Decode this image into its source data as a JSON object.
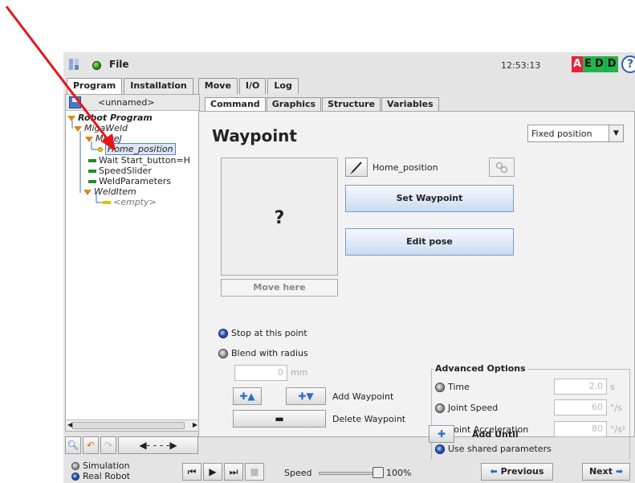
{
  "titlebar": {
    "file_label": "File",
    "clock": "12:53:13",
    "status_letters": [
      "A",
      "E",
      "D",
      "D"
    ],
    "help_label": "?"
  },
  "top_tabs": [
    "Program",
    "Installation",
    "Move",
    "I/O",
    "Log"
  ],
  "left_panel": {
    "program_name": "<unnamed>",
    "tree": [
      {
        "label": "Robot Program",
        "style": "bold-italic",
        "icon": "triangle-icon"
      },
      {
        "label": "MigaWeld",
        "style": "italic",
        "icon": "triangle-icon"
      },
      {
        "label": "MoveJ",
        "style": "italic",
        "icon": "triangle-icon"
      },
      {
        "label": "Home_position",
        "style": "selected-italic",
        "icon": "waypoint-dot-icon"
      },
      {
        "label": "Wait Start_button=H",
        "style": "normal",
        "icon": "command-icon"
      },
      {
        "label": "SpeedSlider",
        "style": "normal",
        "icon": "command-icon"
      },
      {
        "label": "WeldParameters",
        "style": "normal",
        "icon": "command-icon"
      },
      {
        "label": "WeldItem",
        "style": "italic",
        "icon": "triangle-icon"
      },
      {
        "label": "<empty>",
        "style": "muted-italic",
        "icon": "empty-command-icon"
      }
    ]
  },
  "sub_tabs": [
    "Command",
    "Graphics",
    "Structure",
    "Variables"
  ],
  "waypoint": {
    "title": "Waypoint",
    "position_type": "Fixed position",
    "preview_placeholder": "?",
    "move_here_label": "Move here",
    "name": "Home_position",
    "set_waypoint_label": "Set Waypoint",
    "edit_pose_label": "Edit pose",
    "stop_at_point_label": "Stop at this point",
    "blend_label": "Blend with radius",
    "blend_value": "0",
    "blend_unit": "mm",
    "add_waypoint_label": "Add Waypoint",
    "delete_waypoint_label": "Delete Waypoint",
    "add_until_label": "Add Until"
  },
  "advanced": {
    "title": "Advanced Options",
    "time_label": "Time",
    "time_value": "2.0",
    "time_unit": "s",
    "joint_speed_label": "Joint Speed",
    "joint_speed_value": "60",
    "joint_speed_unit": "°/s",
    "joint_accel_label": "Joint Acceleration",
    "joint_accel_value": "80",
    "joint_accel_unit": "°/s²",
    "shared_params_label": "Use shared parameters"
  },
  "bottom": {
    "simulation_label": "Simulation",
    "real_robot_label": "Real Robot",
    "speed_label": "Speed",
    "speed_value": "100%",
    "previous_label": "Previous",
    "next_label": "Next"
  },
  "colors": {
    "accent_blue": "#2f6cc8",
    "status_red": "#e8233c",
    "status_green": "#24b34b",
    "annotation_red": "#e8141b"
  }
}
